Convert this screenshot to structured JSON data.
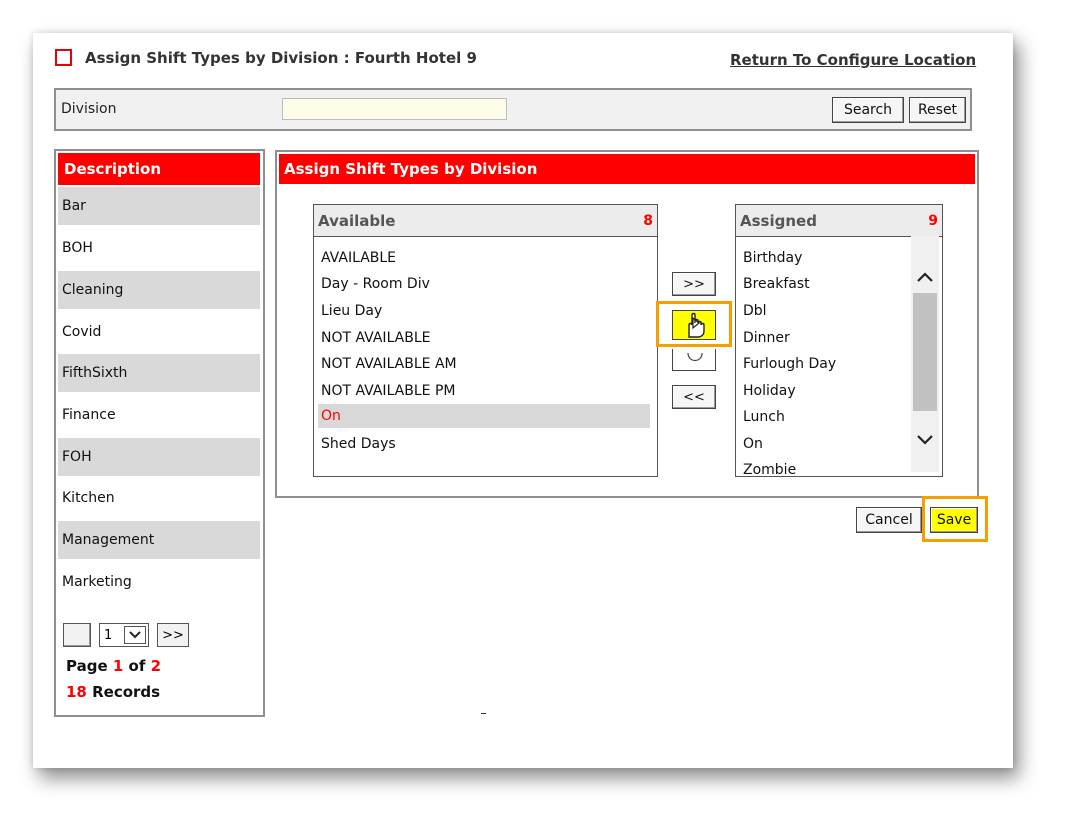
{
  "header": {
    "title": "Assign Shift Types by Division : Fourth Hotel 9",
    "return_link": "Return To Configure Location"
  },
  "search": {
    "division_label": "Division",
    "division_value": "",
    "search_label": "Search",
    "reset_label": "Reset"
  },
  "divisions": {
    "header": "Description",
    "items": [
      "Bar",
      "BOH",
      "Cleaning",
      "Covid",
      "FifthSixth",
      "Finance",
      "FOH",
      "Kitchen",
      "Management",
      "Marketing"
    ]
  },
  "pager": {
    "current_page_select": "1",
    "next_label": ">>",
    "page_word": "Page",
    "page_current": "1",
    "of_word": "of",
    "page_total": "2",
    "records_count": "18",
    "records_word": "Records"
  },
  "assign": {
    "header": "Assign Shift Types by Division",
    "available": {
      "title": "Available",
      "count": "8",
      "items": [
        "AVAILABLE",
        "Day - Room Div",
        "Lieu Day",
        "NOT AVAILABLE",
        "NOT AVAILABLE AM",
        "NOT AVAILABLE PM",
        "On",
        "Shed Days"
      ],
      "selected": "On"
    },
    "assigned": {
      "title": "Assigned",
      "count": "9",
      "items": [
        "Birthday",
        "Breakfast",
        "Dbl",
        "Dinner",
        "Furlough Day",
        "Holiday",
        "Lunch",
        "On",
        "Zombie"
      ]
    },
    "add_all_label": ">>",
    "remove_all_label": "<<"
  },
  "actions": {
    "cancel_label": "Cancel",
    "save_label": "Save"
  },
  "colors": {
    "accent_red": "#ff0000",
    "highlight_yellow": "#ffff00",
    "highlight_orange": "#f5a000"
  },
  "icons": {
    "add_selected": "hand-pointer-icon",
    "scroll_up": "chevron-up-icon",
    "scroll_down": "chevron-down-icon"
  }
}
